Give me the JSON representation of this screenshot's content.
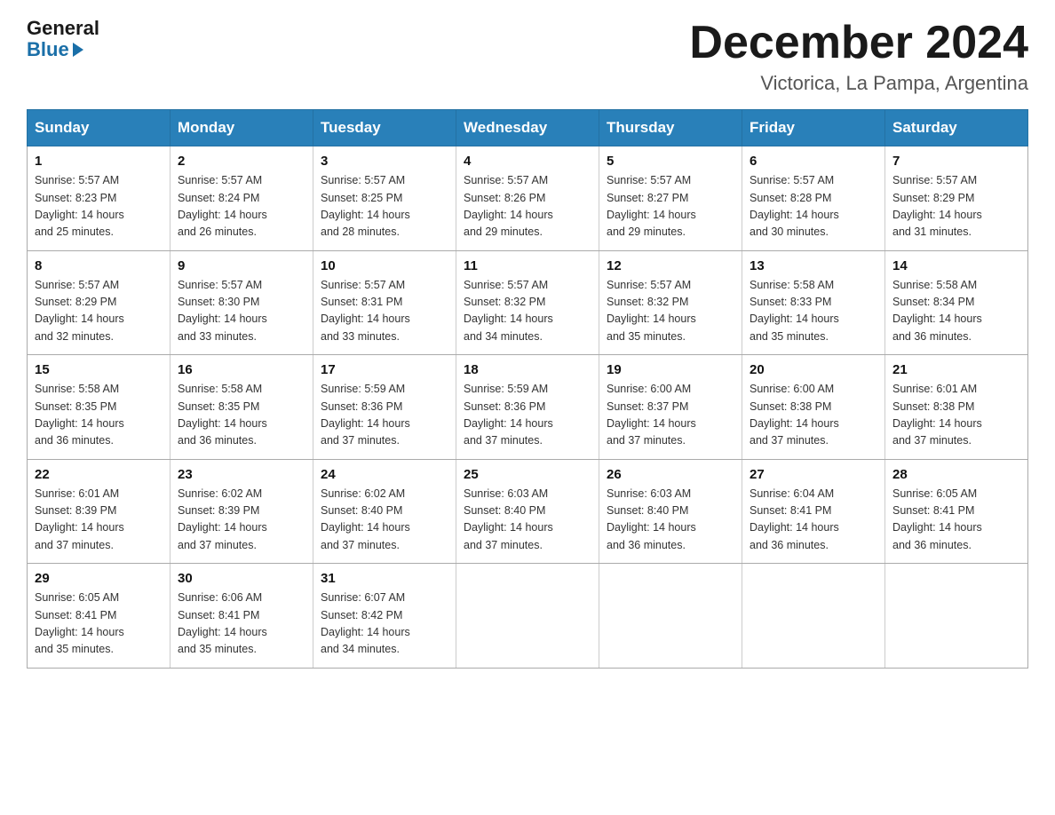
{
  "logo": {
    "general": "General",
    "blue": "Blue"
  },
  "title": {
    "month": "December 2024",
    "location": "Victorica, La Pampa, Argentina"
  },
  "headers": [
    "Sunday",
    "Monday",
    "Tuesday",
    "Wednesday",
    "Thursday",
    "Friday",
    "Saturday"
  ],
  "weeks": [
    [
      {
        "day": "1",
        "sunrise": "5:57 AM",
        "sunset": "8:23 PM",
        "daylight": "14 hours and 25 minutes."
      },
      {
        "day": "2",
        "sunrise": "5:57 AM",
        "sunset": "8:24 PM",
        "daylight": "14 hours and 26 minutes."
      },
      {
        "day": "3",
        "sunrise": "5:57 AM",
        "sunset": "8:25 PM",
        "daylight": "14 hours and 28 minutes."
      },
      {
        "day": "4",
        "sunrise": "5:57 AM",
        "sunset": "8:26 PM",
        "daylight": "14 hours and 29 minutes."
      },
      {
        "day": "5",
        "sunrise": "5:57 AM",
        "sunset": "8:27 PM",
        "daylight": "14 hours and 29 minutes."
      },
      {
        "day": "6",
        "sunrise": "5:57 AM",
        "sunset": "8:28 PM",
        "daylight": "14 hours and 30 minutes."
      },
      {
        "day": "7",
        "sunrise": "5:57 AM",
        "sunset": "8:29 PM",
        "daylight": "14 hours and 31 minutes."
      }
    ],
    [
      {
        "day": "8",
        "sunrise": "5:57 AM",
        "sunset": "8:29 PM",
        "daylight": "14 hours and 32 minutes."
      },
      {
        "day": "9",
        "sunrise": "5:57 AM",
        "sunset": "8:30 PM",
        "daylight": "14 hours and 33 minutes."
      },
      {
        "day": "10",
        "sunrise": "5:57 AM",
        "sunset": "8:31 PM",
        "daylight": "14 hours and 33 minutes."
      },
      {
        "day": "11",
        "sunrise": "5:57 AM",
        "sunset": "8:32 PM",
        "daylight": "14 hours and 34 minutes."
      },
      {
        "day": "12",
        "sunrise": "5:57 AM",
        "sunset": "8:32 PM",
        "daylight": "14 hours and 35 minutes."
      },
      {
        "day": "13",
        "sunrise": "5:58 AM",
        "sunset": "8:33 PM",
        "daylight": "14 hours and 35 minutes."
      },
      {
        "day": "14",
        "sunrise": "5:58 AM",
        "sunset": "8:34 PM",
        "daylight": "14 hours and 36 minutes."
      }
    ],
    [
      {
        "day": "15",
        "sunrise": "5:58 AM",
        "sunset": "8:35 PM",
        "daylight": "14 hours and 36 minutes."
      },
      {
        "day": "16",
        "sunrise": "5:58 AM",
        "sunset": "8:35 PM",
        "daylight": "14 hours and 36 minutes."
      },
      {
        "day": "17",
        "sunrise": "5:59 AM",
        "sunset": "8:36 PM",
        "daylight": "14 hours and 37 minutes."
      },
      {
        "day": "18",
        "sunrise": "5:59 AM",
        "sunset": "8:36 PM",
        "daylight": "14 hours and 37 minutes."
      },
      {
        "day": "19",
        "sunrise": "6:00 AM",
        "sunset": "8:37 PM",
        "daylight": "14 hours and 37 minutes."
      },
      {
        "day": "20",
        "sunrise": "6:00 AM",
        "sunset": "8:38 PM",
        "daylight": "14 hours and 37 minutes."
      },
      {
        "day": "21",
        "sunrise": "6:01 AM",
        "sunset": "8:38 PM",
        "daylight": "14 hours and 37 minutes."
      }
    ],
    [
      {
        "day": "22",
        "sunrise": "6:01 AM",
        "sunset": "8:39 PM",
        "daylight": "14 hours and 37 minutes."
      },
      {
        "day": "23",
        "sunrise": "6:02 AM",
        "sunset": "8:39 PM",
        "daylight": "14 hours and 37 minutes."
      },
      {
        "day": "24",
        "sunrise": "6:02 AM",
        "sunset": "8:40 PM",
        "daylight": "14 hours and 37 minutes."
      },
      {
        "day": "25",
        "sunrise": "6:03 AM",
        "sunset": "8:40 PM",
        "daylight": "14 hours and 37 minutes."
      },
      {
        "day": "26",
        "sunrise": "6:03 AM",
        "sunset": "8:40 PM",
        "daylight": "14 hours and 36 minutes."
      },
      {
        "day": "27",
        "sunrise": "6:04 AM",
        "sunset": "8:41 PM",
        "daylight": "14 hours and 36 minutes."
      },
      {
        "day": "28",
        "sunrise": "6:05 AM",
        "sunset": "8:41 PM",
        "daylight": "14 hours and 36 minutes."
      }
    ],
    [
      {
        "day": "29",
        "sunrise": "6:05 AM",
        "sunset": "8:41 PM",
        "daylight": "14 hours and 35 minutes."
      },
      {
        "day": "30",
        "sunrise": "6:06 AM",
        "sunset": "8:41 PM",
        "daylight": "14 hours and 35 minutes."
      },
      {
        "day": "31",
        "sunrise": "6:07 AM",
        "sunset": "8:42 PM",
        "daylight": "14 hours and 34 minutes."
      },
      null,
      null,
      null,
      null
    ]
  ],
  "labels": {
    "sunrise_prefix": "Sunrise: ",
    "sunset_prefix": "Sunset: ",
    "daylight_prefix": "Daylight: "
  }
}
